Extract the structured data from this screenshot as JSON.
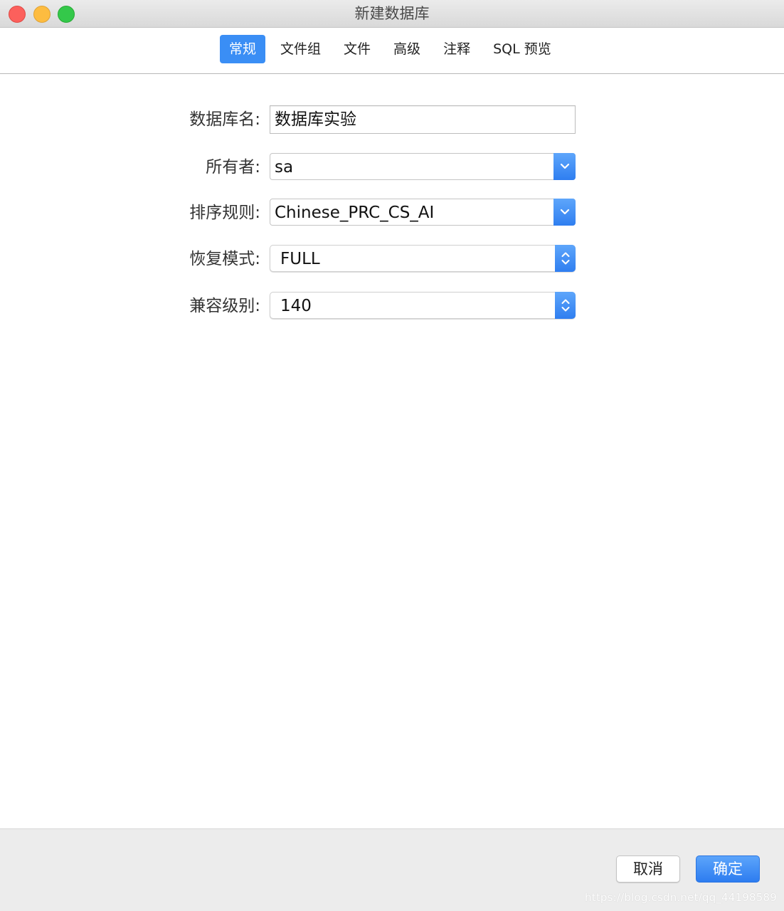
{
  "window": {
    "title": "新建数据库"
  },
  "tabs": [
    {
      "label": "常规",
      "active": true
    },
    {
      "label": "文件组",
      "active": false
    },
    {
      "label": "文件",
      "active": false
    },
    {
      "label": "高级",
      "active": false
    },
    {
      "label": "注释",
      "active": false
    },
    {
      "label": "SQL 预览",
      "active": false
    }
  ],
  "form": {
    "db_name": {
      "label": "数据库名:",
      "value": "数据库实验"
    },
    "owner": {
      "label": "所有者:",
      "value": "sa"
    },
    "collation": {
      "label": "排序规则:",
      "value": "Chinese_PRC_CS_AI"
    },
    "recovery": {
      "label": "恢复模式:",
      "value": "FULL"
    },
    "compat": {
      "label": "兼容级别:",
      "value": "140"
    }
  },
  "footer": {
    "cancel_label": "取消",
    "ok_label": "确定",
    "watermark": "https://blog.csdn.net/qq_44198589"
  },
  "colors": {
    "accent": "#3a8ef5",
    "close": "#fc605c",
    "minimize": "#fdbc40",
    "maximize": "#34c84a"
  },
  "icons": {
    "combo_button": "chevron-down-icon",
    "popup_button": "up-down-arrows-icon"
  }
}
